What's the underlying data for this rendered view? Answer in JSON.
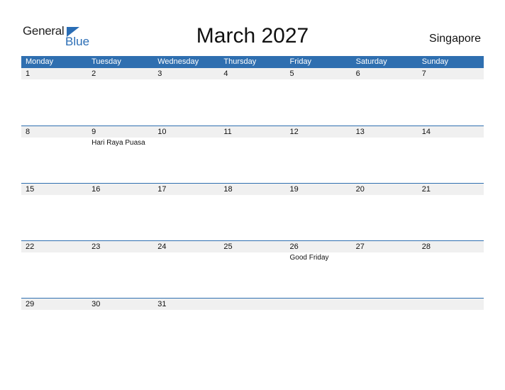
{
  "logo": {
    "general": "General",
    "blue": "Blue"
  },
  "title": "March 2027",
  "country": "Singapore",
  "colors": {
    "accent": "#2f6fb0",
    "strip": "#f0f0f0"
  },
  "days": [
    "Monday",
    "Tuesday",
    "Wednesday",
    "Thursday",
    "Friday",
    "Saturday",
    "Sunday"
  ],
  "weeks": [
    {
      "dates": [
        "1",
        "2",
        "3",
        "4",
        "5",
        "6",
        "7"
      ],
      "events": [
        "",
        "",
        "",
        "",
        "",
        "",
        ""
      ]
    },
    {
      "dates": [
        "8",
        "9",
        "10",
        "11",
        "12",
        "13",
        "14"
      ],
      "events": [
        "",
        "Hari Raya Puasa",
        "",
        "",
        "",
        "",
        ""
      ]
    },
    {
      "dates": [
        "15",
        "16",
        "17",
        "18",
        "19",
        "20",
        "21"
      ],
      "events": [
        "",
        "",
        "",
        "",
        "",
        "",
        ""
      ]
    },
    {
      "dates": [
        "22",
        "23",
        "24",
        "25",
        "26",
        "27",
        "28"
      ],
      "events": [
        "",
        "",
        "",
        "",
        "Good Friday",
        "",
        ""
      ]
    },
    {
      "dates": [
        "29",
        "30",
        "31",
        "",
        "",
        "",
        ""
      ],
      "events": [
        "",
        "",
        "",
        "",
        "",
        "",
        ""
      ]
    }
  ]
}
